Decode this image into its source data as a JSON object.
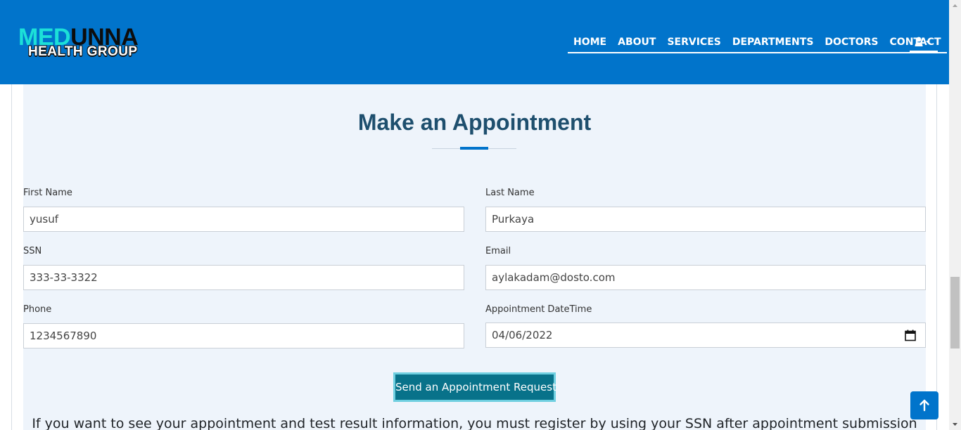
{
  "header": {
    "logo": {
      "part1": "MED",
      "part2": "UNNA",
      "subtitle": "HEALTH GROUP"
    },
    "nav": [
      {
        "label": "HOME"
      },
      {
        "label": "ABOUT"
      },
      {
        "label": "SERVICES"
      },
      {
        "label": "DEPARTMENTS"
      },
      {
        "label": "DOCTORS"
      },
      {
        "label": "CONTACT"
      }
    ],
    "user_menu_icon": "user-icon",
    "dropdown_icon": "caret-down-icon"
  },
  "form": {
    "title": "Make an Appointment",
    "first_name": {
      "label": "First Name",
      "value": "yusuf"
    },
    "last_name": {
      "label": "Last Name",
      "value": "Purkaya"
    },
    "ssn": {
      "label": "SSN",
      "value": "333-33-3322"
    },
    "email": {
      "label": "Email",
      "value": "aylakadam@dosto.com"
    },
    "phone": {
      "label": "Phone",
      "value": "1234567890"
    },
    "datetime": {
      "label": "Appointment DateTime",
      "value": "04/06/2022",
      "icon": "calendar-icon"
    },
    "submit_label": "Send an Appointment Request",
    "info": "If you want to see your appointment and test result information, you must register by using your SSN after appointment submission"
  },
  "scroll_top_icon": "arrow-up-icon",
  "colors": {
    "header_bg": "#0174cb",
    "logo_accent": "#1ce0d8",
    "title": "#1e4f6e",
    "form_bg": "#eef4fb",
    "button_bg": "#08728a",
    "button_border": "#6fcfe0"
  }
}
